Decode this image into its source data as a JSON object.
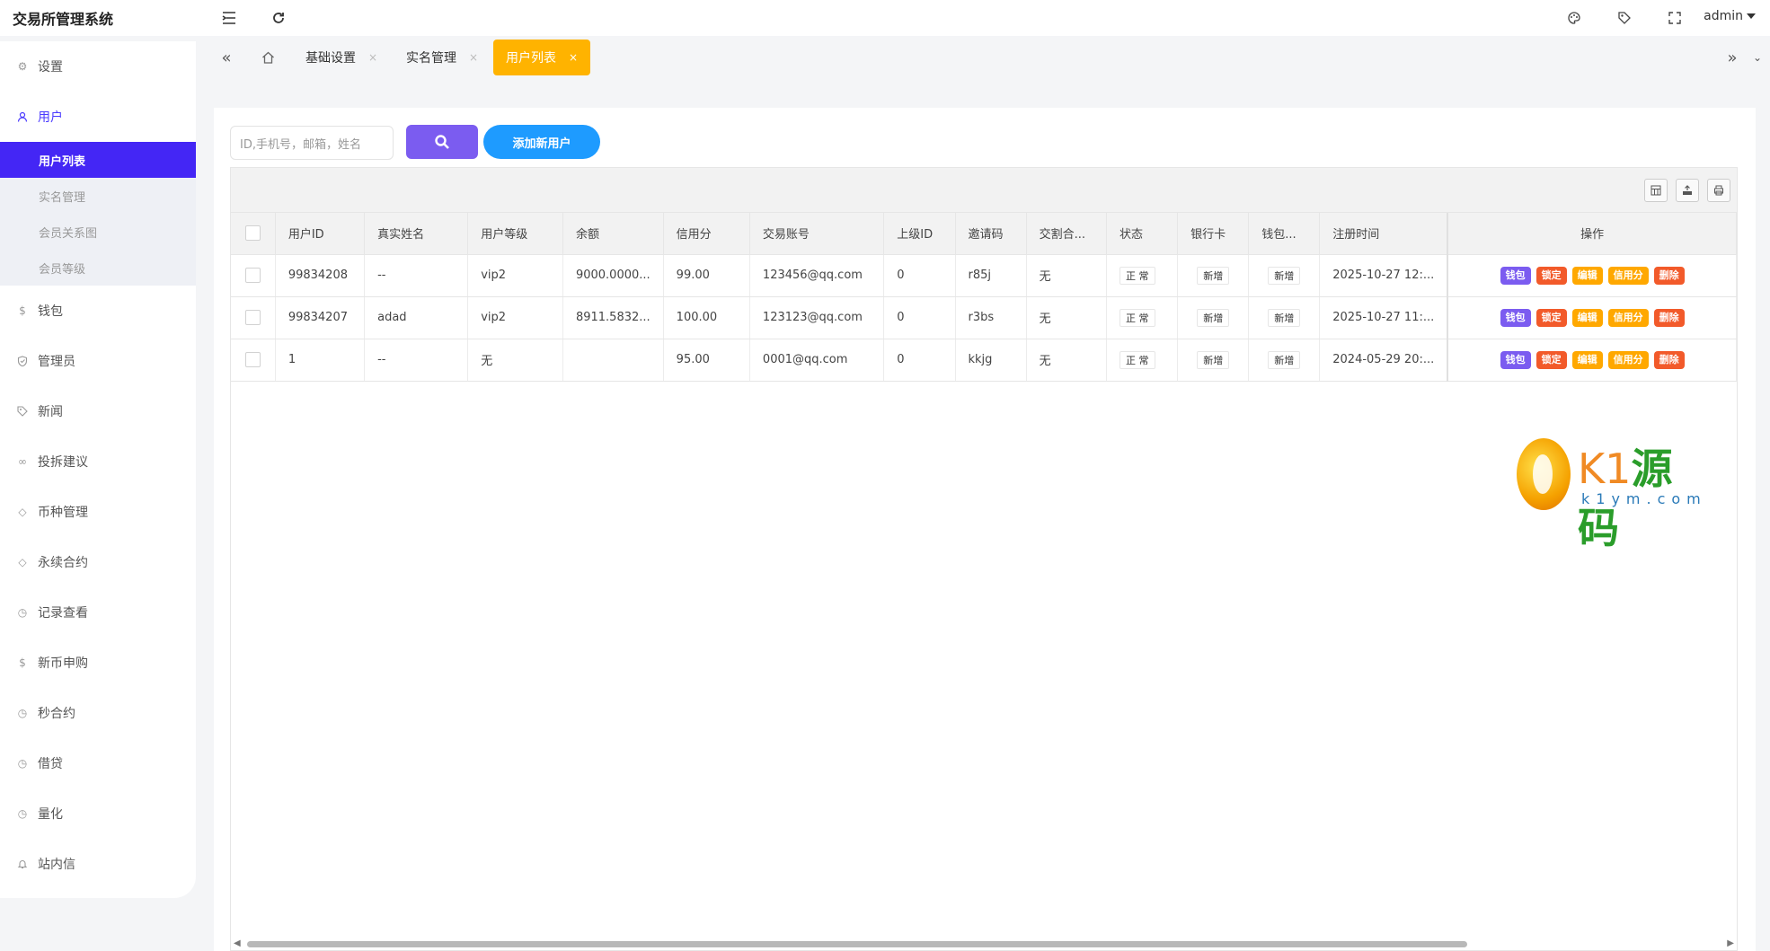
{
  "app": {
    "title": "交易所管理系统",
    "user": "admin"
  },
  "sidebar": {
    "items": [
      {
        "label": "设置",
        "icon": "gear-icon"
      },
      {
        "label": "用户",
        "icon": "user-icon"
      },
      {
        "label": "钱包",
        "icon": "dollar-icon"
      },
      {
        "label": "管理员",
        "icon": "shield-icon"
      },
      {
        "label": "新闻",
        "icon": "tag-icon"
      },
      {
        "label": "投拆建议",
        "icon": "link-icon"
      },
      {
        "label": "币种管理",
        "icon": "diamond-icon"
      },
      {
        "label": "永续合约",
        "icon": "diamond-icon"
      },
      {
        "label": "记录查看",
        "icon": "clock-icon"
      },
      {
        "label": "新币申购",
        "icon": "dollar-icon"
      },
      {
        "label": "秒合约",
        "icon": "clock-icon"
      },
      {
        "label": "借贷",
        "icon": "clock-icon"
      },
      {
        "label": "量化",
        "icon": "clock-icon"
      },
      {
        "label": "站内信",
        "icon": "bell-icon"
      }
    ],
    "user_submenu": [
      "用户列表",
      "实名管理",
      "会员关系图",
      "会员等级"
    ]
  },
  "tabs": [
    {
      "label": "基础设置"
    },
    {
      "label": "实名管理"
    },
    {
      "label": "用户列表"
    }
  ],
  "search": {
    "placeholder": "ID,手机号，邮箱，姓名",
    "add_label": "添加新用户"
  },
  "table": {
    "columns": [
      "用户ID",
      "真实姓名",
      "用户等级",
      "余额",
      "信用分",
      "交易账号",
      "上级ID",
      "邀请码",
      "交割合...",
      "状态",
      "银行卡",
      "钱包...",
      "注册时间",
      "操作"
    ],
    "rows": [
      {
        "id": "99834208",
        "name": "--",
        "level": "vip2",
        "balance": "9000.0000...",
        "credit": "99.00",
        "account": "123456@qq.com",
        "parent": "0",
        "invite": "r85j",
        "delivery": "无",
        "status": "正 常",
        "bank": "新增",
        "wallet": "新增",
        "registered": "2025-10-27 12:..."
      },
      {
        "id": "99834207",
        "name": "adad",
        "level": "vip2",
        "balance": "8911.5832...",
        "credit": "100.00",
        "account": "123123@qq.com",
        "parent": "0",
        "invite": "r3bs",
        "delivery": "无",
        "status": "正 常",
        "bank": "新增",
        "wallet": "新增",
        "registered": "2025-10-27 11:..."
      },
      {
        "id": "1",
        "name": "--",
        "level": "无",
        "balance": "",
        "credit": "95.00",
        "account": "0001@qq.com",
        "parent": "0",
        "invite": "kkjg",
        "delivery": "无",
        "status": "正 常",
        "bank": "新增",
        "wallet": "新增",
        "registered": "2024-05-29 20:..."
      }
    ],
    "actions": [
      "钱包",
      "锁定",
      "编辑",
      "信用分",
      "删除"
    ]
  },
  "watermark": {
    "brand_a": "K1",
    "brand_b": "源码",
    "domain": "k1ym.com"
  },
  "colors": {
    "accent": "#4426f5",
    "tab_active": "#ffb300",
    "search_button": "#7b5cf0",
    "add_button": "#1e9bff",
    "warning": "#ffa800",
    "danger": "#f25a2a"
  }
}
